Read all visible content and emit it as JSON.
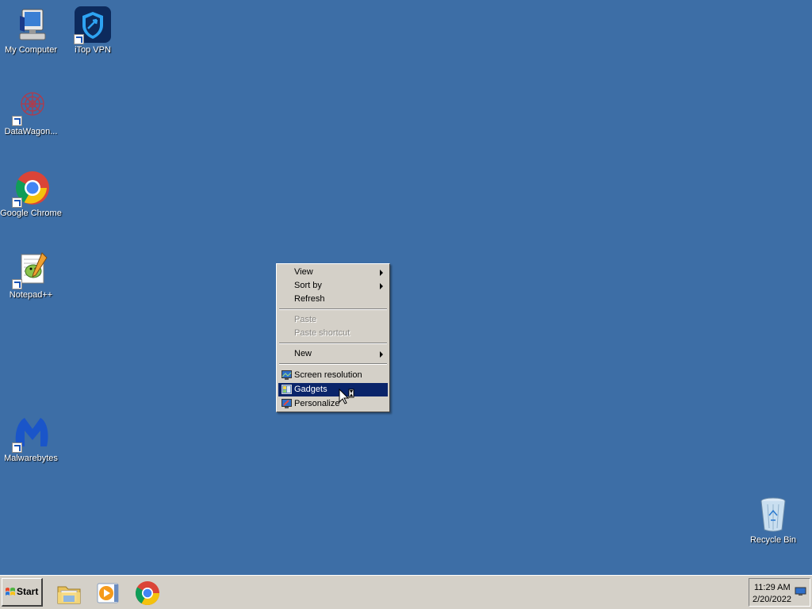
{
  "desktop": {
    "icons": [
      {
        "label": "My Computer"
      },
      {
        "label": "iTop VPN"
      },
      {
        "label": "DataWagon..."
      },
      {
        "label": "Google Chrome"
      },
      {
        "label": "Notepad++"
      },
      {
        "label": "Malwarebytes"
      },
      {
        "label": "Recycle Bin"
      }
    ]
  },
  "context_menu": {
    "items": [
      {
        "label": "View",
        "submenu": true,
        "enabled": true
      },
      {
        "label": "Sort by",
        "submenu": true,
        "enabled": true
      },
      {
        "label": "Refresh",
        "enabled": true
      },
      {
        "label": "Paste",
        "enabled": false
      },
      {
        "label": "Paste shortcut",
        "enabled": false
      },
      {
        "label": "New",
        "submenu": true,
        "enabled": true
      },
      {
        "label": "Screen resolution",
        "icon": "screen-resolution-icon",
        "enabled": true
      },
      {
        "label": "Gadgets",
        "icon": "gadgets-icon",
        "enabled": true,
        "highlighted": true
      },
      {
        "label": "Personalize",
        "icon": "personalize-icon",
        "enabled": true
      }
    ]
  },
  "taskbar": {
    "start_label": "Start",
    "pinned": [
      {
        "icon": "file-explorer-icon"
      },
      {
        "icon": "media-player-icon"
      },
      {
        "icon": "chrome-icon"
      }
    ],
    "clock": {
      "time": "11:29 AM",
      "date": "2/20/2022"
    }
  },
  "colors": {
    "desktop_bg": "#3d6ea6",
    "menu_highlight": "#0a246a",
    "taskbar_bg": "#d4d0c8"
  }
}
